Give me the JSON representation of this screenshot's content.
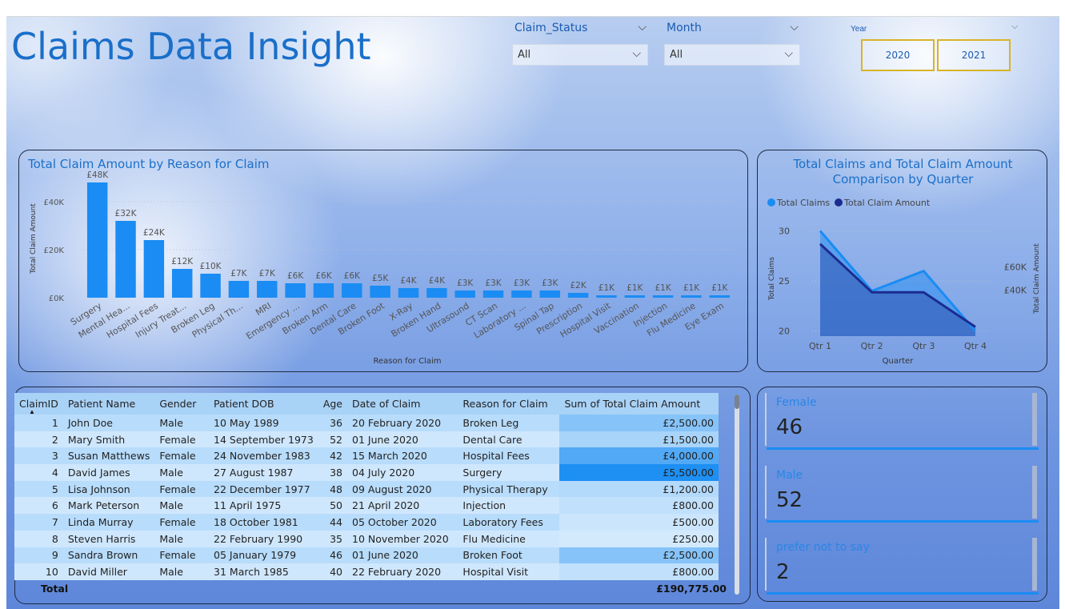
{
  "title": "Claims Data Insight",
  "slicers": {
    "claim_status": {
      "label": "Claim_Status",
      "value": "All"
    },
    "month": {
      "label": "Month",
      "value": "All"
    },
    "year": {
      "label": "Year",
      "options": [
        "2020",
        "2021"
      ]
    }
  },
  "colors": {
    "accent": "#1a8cf3",
    "title": "#1a6fc9",
    "dark_series": "#1b2c8f",
    "year_border": "#d8b428"
  },
  "bar_chart": {
    "title": "Total Claim Amount by Reason for Claim",
    "chart_data": {
      "type": "bar",
      "categories": [
        "Surgery",
        "Mental Hea...",
        "Hospital Fees",
        "Injury Treat...",
        "Broken Leg",
        "Physical Th...",
        "MRI",
        "Emergency ...",
        "Broken Arm",
        "Dental Care",
        "Broken Foot",
        "X-Ray",
        "Broken Hand",
        "Ultrasound",
        "CT Scan",
        "Laboratory ...",
        "Spinal Tap",
        "Prescription",
        "Hospital Visit",
        "Vaccination",
        "Injection",
        "Flu Medicine",
        "Eye Exam"
      ],
      "values": [
        48000,
        32000,
        24000,
        12000,
        10000,
        7000,
        7000,
        6000,
        6000,
        6000,
        5000,
        4000,
        4000,
        3000,
        3000,
        3000,
        3000,
        2000,
        1000,
        1000,
        1000,
        1000,
        1000
      ],
      "data_labels": [
        "£48K",
        "£32K",
        "£24K",
        "£12K",
        "£10K",
        "£7K",
        "£7K",
        "£6K",
        "£6K",
        "£6K",
        "£5K",
        "£4K",
        "£4K",
        "£3K",
        "£3K",
        "£3K",
        "£3K",
        "£2K",
        "£1K",
        "£1K",
        "£1K",
        "£1K",
        "£1K"
      ],
      "xlabel": "Reason for Claim",
      "ylabel": "Total Claim Amount",
      "yticks": [
        "£0K",
        "£20K",
        "£40K"
      ],
      "ytick_values": [
        0,
        20000,
        40000
      ],
      "ylim": [
        0,
        50000
      ],
      "color": "#1a8cf3"
    }
  },
  "area_chart": {
    "title_line1": "Total Claims and Total Claim Amount",
    "title_line2": "Comparison by Quarter",
    "chart_data": {
      "type": "area",
      "categories": [
        "Qtr 1",
        "Qtr 2",
        "Qtr 3",
        "Qtr 4"
      ],
      "series": [
        {
          "name": "Total Claims",
          "values": [
            30,
            24,
            26,
            20
          ],
          "color": "#1a8cf3",
          "axis": "left"
        },
        {
          "name": "Total Claim Amount",
          "values": [
            80000,
            38000,
            38000,
            8000
          ],
          "color": "#1b2c8f",
          "axis": "right"
        }
      ],
      "xlabel": "Quarter",
      "ylabel": "Total Claims",
      "y2label": "Total Claim Amount",
      "yticks": [
        "20",
        "25",
        "30"
      ],
      "ytick_values": [
        20,
        25,
        30
      ],
      "ylim": [
        19.5,
        31
      ],
      "y2ticks": [
        "£40K",
        "£60K"
      ],
      "y2tick_values": [
        40000,
        60000
      ],
      "y2lim": [
        0,
        100000
      ],
      "legend": "top-left"
    }
  },
  "table": {
    "columns": [
      "ClaimID",
      "Patient Name",
      "Gender",
      "Patient DOB",
      "Age",
      "Date of Claim",
      "Reason for Claim",
      "Sum of Total Claim Amount"
    ],
    "rows": [
      [
        "1",
        "John Doe",
        "Male",
        "10 May 1989",
        "36",
        "20 February 2020",
        "Broken Leg",
        "£2,500.00"
      ],
      [
        "2",
        "Mary Smith",
        "Female",
        "14 September 1973",
        "52",
        "01 June 2020",
        "Dental Care",
        "£1,500.00"
      ],
      [
        "3",
        "Susan Matthews",
        "Female",
        "24 November 1983",
        "42",
        "15 March 2020",
        "Hospital Fees",
        "£4,000.00"
      ],
      [
        "4",
        "David James",
        "Male",
        "27 August 1987",
        "38",
        "04 July 2020",
        "Surgery",
        "£5,500.00"
      ],
      [
        "5",
        "Lisa Johnson",
        "Female",
        "22 December 1977",
        "48",
        "09 August 2020",
        "Physical Therapy",
        "£1,200.00"
      ],
      [
        "6",
        "Mark Peterson",
        "Male",
        "11 April 1975",
        "50",
        "21 April 2020",
        "Injection",
        "£800.00"
      ],
      [
        "7",
        "Linda Murray",
        "Female",
        "18 October 1981",
        "44",
        "05 October 2020",
        "Laboratory Fees",
        "£500.00"
      ],
      [
        "8",
        "Steven Harris",
        "Male",
        "22 February 1990",
        "35",
        "10 November 2020",
        "Flu Medicine",
        "£250.00"
      ],
      [
        "9",
        "Sandra Brown",
        "Female",
        "05 January 1979",
        "46",
        "01 June 2020",
        "Broken Foot",
        "£2,500.00"
      ],
      [
        "10",
        "David Miller",
        "Male",
        "31 March 1985",
        "40",
        "22 February 2020",
        "Hospital Visit",
        "£800.00"
      ]
    ],
    "amounts": [
      2500,
      1500,
      4000,
      5500,
      1200,
      800,
      500,
      250,
      2500,
      800
    ],
    "total_label": "Total",
    "total_value": "£190,775.00"
  },
  "cards": [
    {
      "label": "Female",
      "value": "46"
    },
    {
      "label": "Male",
      "value": "52"
    },
    {
      "label": "prefer not to say",
      "value": "2"
    }
  ]
}
